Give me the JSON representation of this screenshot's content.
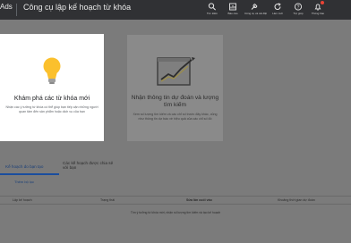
{
  "header": {
    "brand": "Ads",
    "title": "Công cụ lập kế hoạch từ khóa",
    "tools": [
      {
        "label": "Tìm kiếm",
        "icon": "search-icon"
      },
      {
        "label": "Báo cáo",
        "icon": "reports-icon"
      },
      {
        "label": "Công cụ và cài đặt",
        "icon": "tools-icon"
      },
      {
        "label": "Làm mới",
        "icon": "refresh-icon"
      },
      {
        "label": "Trợ giúp",
        "icon": "help-icon"
      },
      {
        "label": "Thông báo",
        "icon": "notifications-icon"
      }
    ]
  },
  "cards": {
    "discover": {
      "title": "Khám phá các từ khóa mới",
      "desc": "Nhận các ý tưởng từ khóa có thể giúp bạn tiếp cận những người quan tâm đến sản phẩm hoặc dịch vụ của bạn"
    },
    "forecast": {
      "title": "Nhận thông tin dự đoán và lượng tìm kiếm",
      "desc": "Xem số lượng tìm kiếm và các chỉ số trước đây khác, cũng như thông tin dự báo về hiệu quả của các chỉ số đó"
    }
  },
  "tabs": {
    "active": "Kế hoạch do bạn tạo",
    "other": "Các kế hoạch được chia sẻ với bạn"
  },
  "add_filter": "Thêm bộ lọc",
  "table": {
    "columns": [
      "Lập kế hoạch",
      "Trạng thái",
      "Sửa lần cuối vào",
      "Khoảng thời gian dự đoán"
    ],
    "empty_message": "Tìm ý tưởng từ khóa mới, nhận số lượng tìm kiếm và tạo kế hoạch"
  },
  "colors": {
    "topbar": "#303134",
    "accent": "#1a4d9e",
    "bulb": "#fbc02d"
  }
}
